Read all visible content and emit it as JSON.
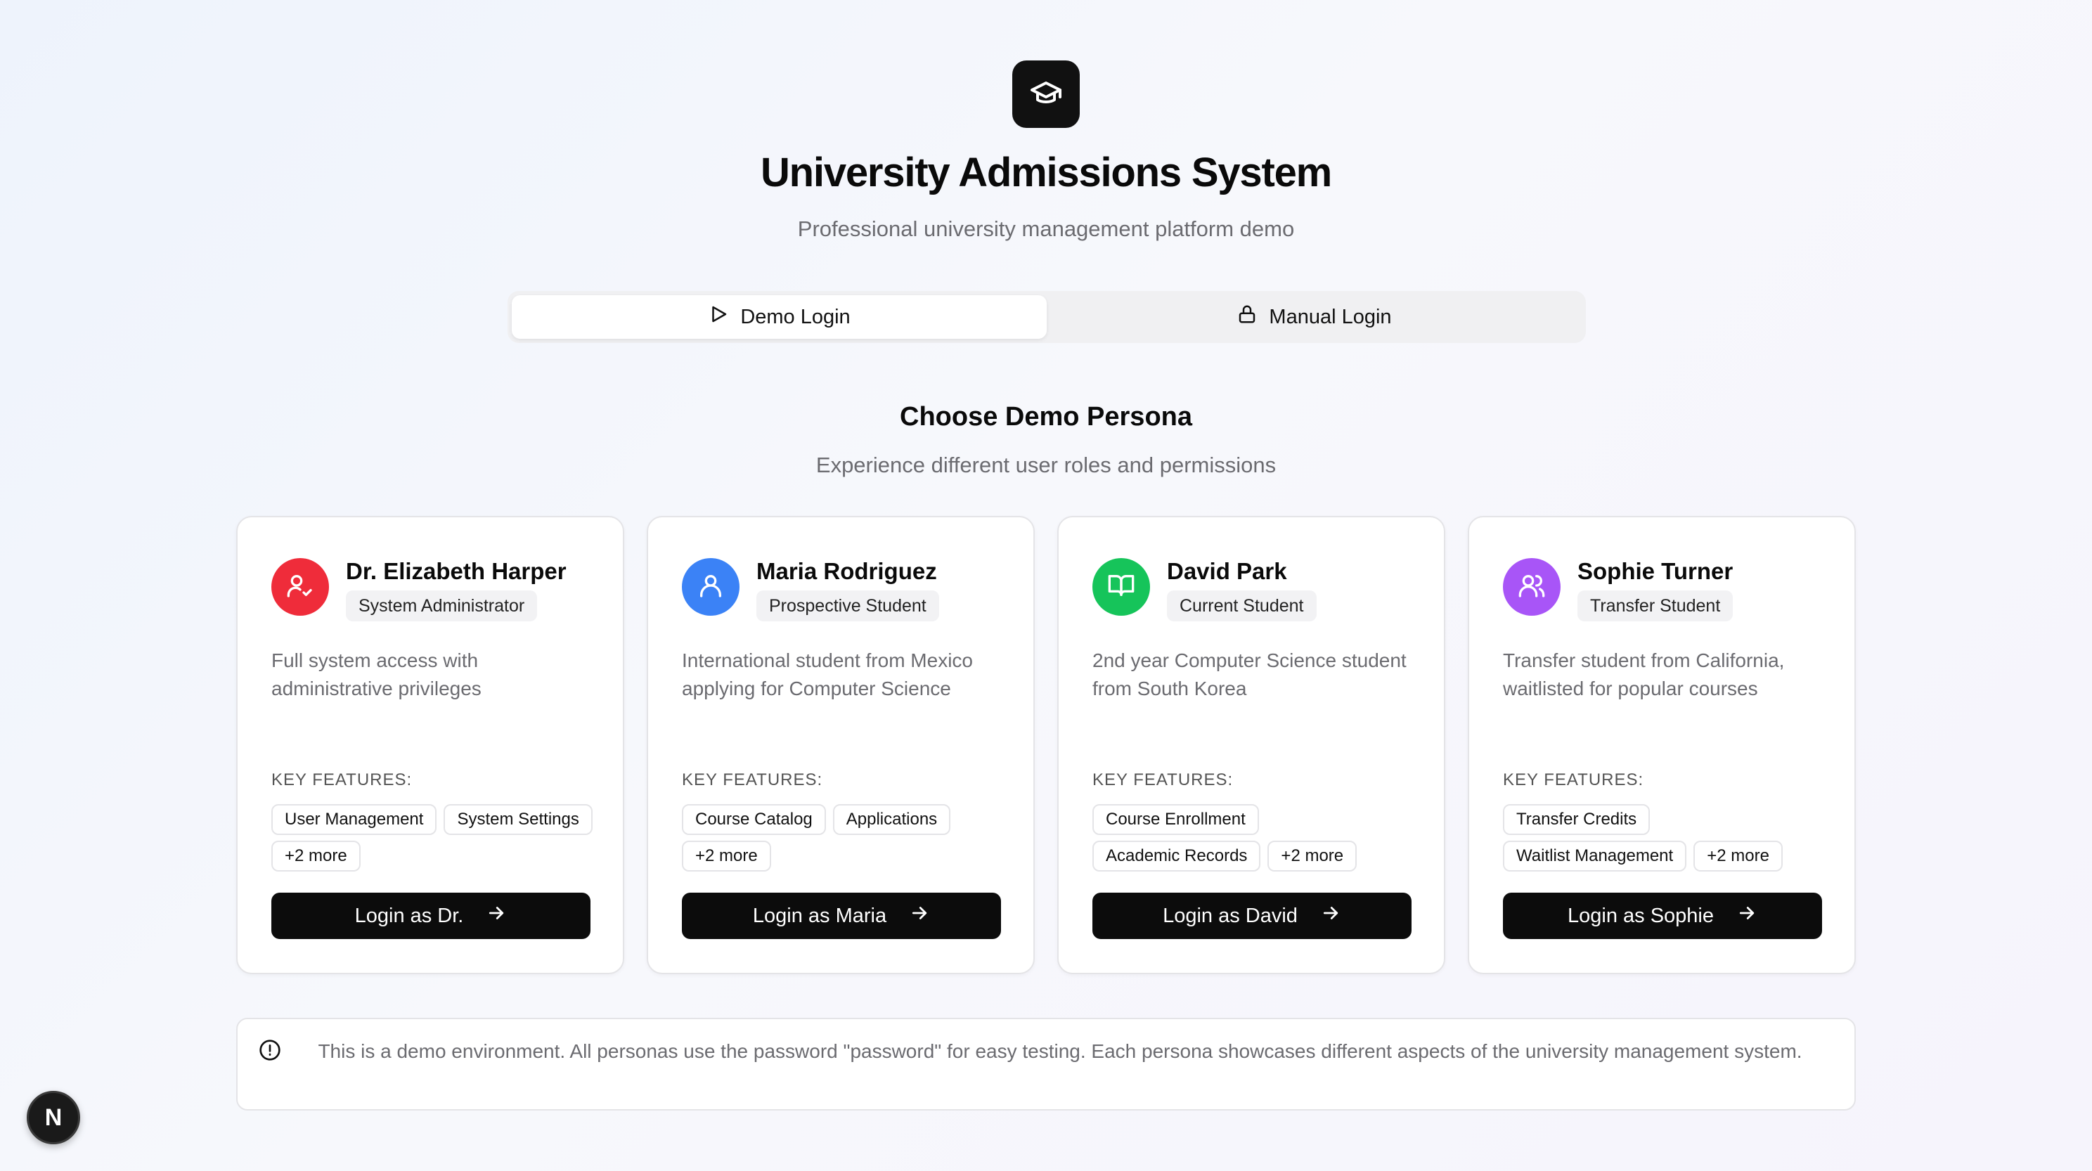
{
  "header": {
    "logo_icon": "graduation-cap-icon",
    "title": "University Admissions System",
    "subtitle": "Professional university management platform demo"
  },
  "tabs": [
    {
      "label": "Demo Login",
      "icon": "play-icon",
      "active": true
    },
    {
      "label": "Manual Login",
      "icon": "lock-icon",
      "active": false
    }
  ],
  "section": {
    "title": "Choose Demo Persona",
    "subtitle": "Experience different user roles and permissions"
  },
  "personas": [
    {
      "name": "Dr. Elizabeth Harper",
      "role": "System Administrator",
      "description": "Full system access with administrative privileges",
      "features_label": "KEY FEATURES:",
      "features": [
        "User Management",
        "System Settings",
        "+2 more"
      ],
      "button": "Login as Dr.",
      "color": "#ef2c3a",
      "icon": "user-check-icon"
    },
    {
      "name": "Maria Rodriguez",
      "role": "Prospective Student",
      "description": "International student from Mexico applying for Computer Science",
      "features_label": "KEY FEATURES:",
      "features": [
        "Course Catalog",
        "Applications",
        "+2 more"
      ],
      "button": "Login as Maria",
      "color": "#3b82f6",
      "icon": "user-icon"
    },
    {
      "name": "David Park",
      "role": "Current Student",
      "description": "2nd year Computer Science student from South Korea",
      "features_label": "KEY FEATURES:",
      "features": [
        "Course Enrollment",
        "Academic Records",
        "+2 more"
      ],
      "button": "Login as David",
      "color": "#16c45a",
      "icon": "book-open-icon"
    },
    {
      "name": "Sophie Turner",
      "role": "Transfer Student",
      "description": "Transfer student from California, waitlisted for popular courses",
      "features_label": "KEY FEATURES:",
      "features": [
        "Transfer Credits",
        "Waitlist Management",
        "+2 more"
      ],
      "button": "Login as Sophie",
      "color": "#a855f7",
      "icon": "users-icon"
    }
  ],
  "notice": {
    "icon": "info-circle-icon",
    "text": "This is a demo environment. All personas use the password \"password\" for easy testing. Each persona showcases different aspects of the university management system."
  },
  "dev_badge": {
    "letter": "N"
  }
}
